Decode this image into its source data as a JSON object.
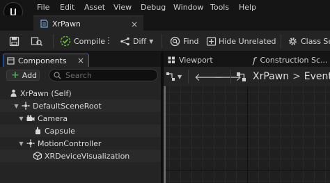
{
  "menubar": {
    "items": [
      "File",
      "Edit",
      "Asset",
      "View",
      "Debug",
      "Window",
      "Tools",
      "Help"
    ]
  },
  "document_tab": {
    "title": "XrPawn",
    "close_glyph": "×"
  },
  "toolbar": {
    "compile_label": "Compile",
    "diff_label": "Diff",
    "find_label": "Find",
    "hide_unrelated_label": "Hide Unrelated",
    "class_settings_label": "Class Setti"
  },
  "components_panel": {
    "tab_label": "Components",
    "close_glyph": "×",
    "add_label": "Add",
    "search_placeholder": "Search",
    "tree": [
      {
        "label": "XrPawn (Self)",
        "icon": "pawn-icon",
        "depth": 0,
        "expandable": false
      },
      {
        "label": "DefaultSceneRoot",
        "icon": "scene-root-icon",
        "depth": 1,
        "expandable": true
      },
      {
        "label": "Camera",
        "icon": "camera-icon",
        "depth": 2,
        "expandable": true
      },
      {
        "label": "Capsule",
        "icon": "capsule-icon",
        "depth": 3,
        "expandable": false
      },
      {
        "label": "MotionController",
        "icon": "motion-controller-icon",
        "depth": 2,
        "expandable": true
      },
      {
        "label": "XRDeviceVisualization",
        "icon": "mesh-icon",
        "depth": 3,
        "expandable": false
      }
    ]
  },
  "right_panel": {
    "viewport_tab": "Viewport",
    "construction_tab": "Construction Sc...",
    "breadcrumb": {
      "root": "XrPawn",
      "separator": ">",
      "current": "Event"
    }
  },
  "colors": {
    "accent_blue": "#3a6dc5",
    "add_green": "#37b34a",
    "compile_green": "#5fbf3a",
    "panel_bg": "#242424",
    "app_bg": "#151515"
  }
}
